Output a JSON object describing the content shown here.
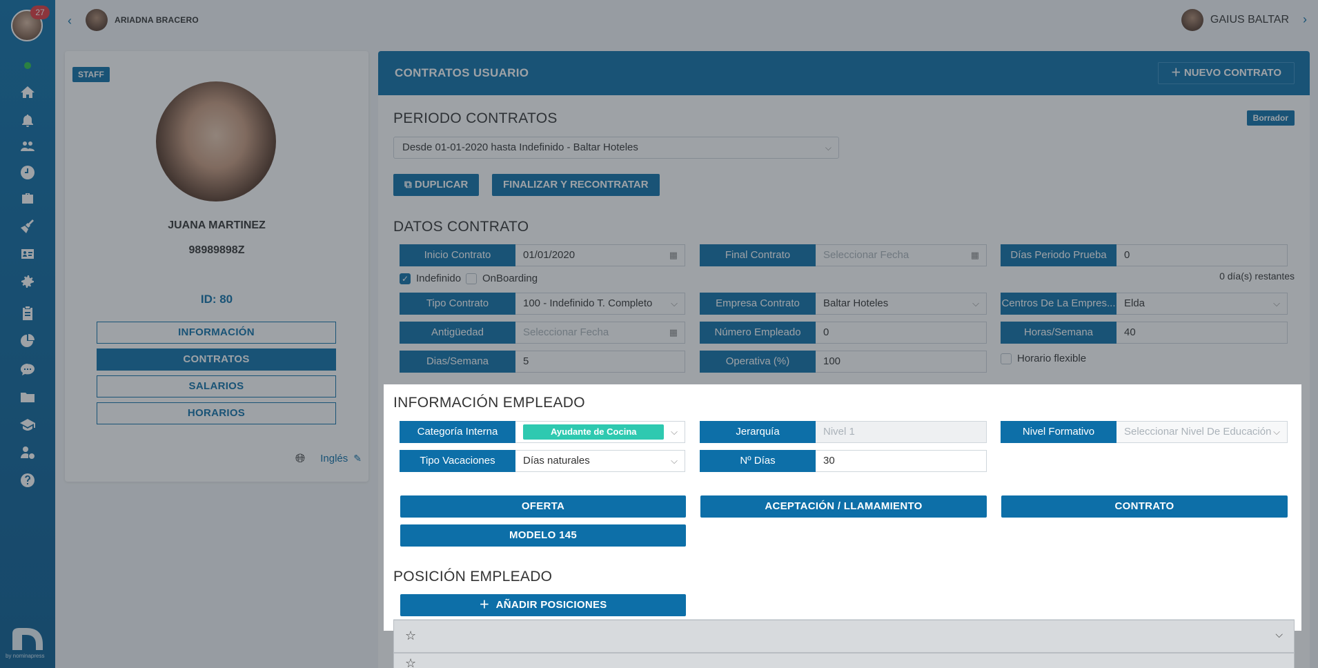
{
  "sidebar": {
    "badge_count": "27",
    "icons": [
      "home-icon",
      "bell-icon",
      "users-icon",
      "clock-icon",
      "briefcase-icon",
      "broom-icon",
      "id-card-icon",
      "gear-icon",
      "clipboard-icon",
      "pie-chart-icon",
      "chat-icon",
      "folder-icon",
      "graduation-cap-icon",
      "user-money-icon",
      "help-icon"
    ],
    "logo_text": "by nominapress"
  },
  "topbar": {
    "left_user": "ARIADNA BRACERO",
    "right_user": "GAIUS BALTAR"
  },
  "profile": {
    "badge": "STAFF",
    "name": "JUANA MARTINEZ",
    "dni": "98989898Z",
    "id": "ID: 80",
    "buttons": [
      "INFORMACIÓN",
      "CONTRATOS",
      "SALARIOS",
      "HORARIOS"
    ],
    "language": "Inglés"
  },
  "main": {
    "title": "CONTRATOS USUARIO",
    "new_contract": "NUEVO CONTRATO",
    "periodo_title": "PERIODO CONTRATOS",
    "status": "Borrador",
    "period_value": "Desde 01-01-2020 hasta Indefinido - Baltar Hoteles",
    "duplicate": "DUPLICAR",
    "finalize": "FINALIZAR Y RECONTRATAR",
    "datos_title": "DATOS CONTRATO",
    "inicio_label": "Inicio Contrato",
    "inicio_value": "01/01/2020",
    "final_label": "Final Contrato",
    "final_placeholder": "Seleccionar Fecha",
    "prueba_label": "Días Periodo Prueba",
    "prueba_value": "0",
    "indefinido": "Indefinido",
    "onboarding": "OnBoarding",
    "restantes": "0 día(s) restantes",
    "tipo_label": "Tipo Contrato",
    "tipo_value": "100 - Indefinido T. Completo",
    "empresa_label": "Empresa Contrato",
    "empresa_value": "Baltar Hoteles",
    "centros_label": "Centros De La Empres...",
    "centros_value": "Elda",
    "antig_label": "Antigüedad",
    "antig_placeholder": "Seleccionar Fecha",
    "numemp_label": "Número Empleado",
    "numemp_value": "0",
    "horas_label": "Horas/Semana",
    "horas_value": "40",
    "dias_label": "Dias/Semana",
    "dias_value": "5",
    "operativa_label": "Operativa (%)",
    "operativa_value": "100",
    "flexible": "Horario flexible",
    "info_title": "INFORMACIÓN EMPLEADO",
    "cat_label": "Categoría Interna",
    "cat_value": "Ayudante de Cocina",
    "jer_label": "Jerarquía",
    "jer_value": "Nivel 1",
    "nivel_label": "Nivel Formativo",
    "nivel_placeholder": "Seleccionar Nivel De Educación",
    "vac_label": "Tipo Vacaciones",
    "vac_value": "Días naturales",
    "ndias_label": "Nº Días",
    "ndias_value": "30",
    "oferta": "OFERTA",
    "aceptacion": "ACEPTACIÓN / LLAMAMIENTO",
    "contrato": "CONTRATO",
    "modelo": "MODELO 145",
    "posicion_title": "POSICIÓN EMPLEADO",
    "add_pos": "AÑADIR POSICIONES"
  }
}
